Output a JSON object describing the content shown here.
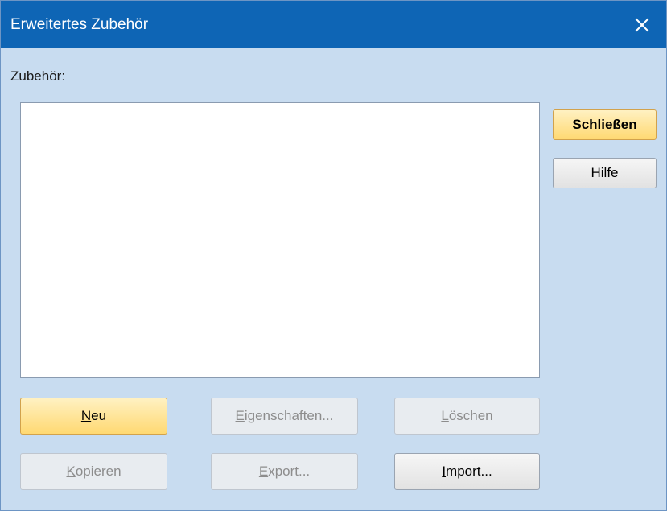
{
  "window": {
    "title": "Erweitertes Zubehör",
    "close_icon": "close-icon"
  },
  "accessories": {
    "label": "Zubehör:",
    "items": []
  },
  "side_buttons": {
    "close": {
      "mnemonic": "S",
      "rest": "chließen"
    },
    "help": {
      "label": "Hilfe"
    }
  },
  "bottom_buttons": {
    "new": {
      "mnemonic": "N",
      "rest": "eu"
    },
    "properties": {
      "mnemonic": "E",
      "rest": "igenschaften..."
    },
    "delete": {
      "mnemonic": "L",
      "rest": "öschen"
    },
    "copy": {
      "mnemonic": "K",
      "rest": "opieren"
    },
    "export": {
      "mnemonic": "E",
      "rest": "xport..."
    },
    "import": {
      "mnemonic": "I",
      "rest": "mport..."
    }
  },
  "colors": {
    "titlebar": "#0e65b5",
    "dialog_background": "#c8dcf0",
    "default_button": "#ffd972"
  }
}
